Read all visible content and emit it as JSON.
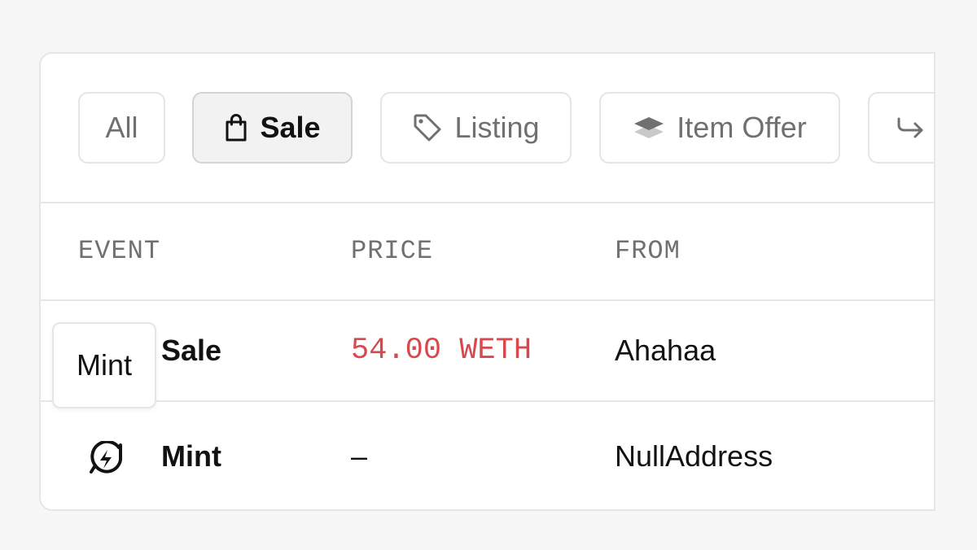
{
  "filters": [
    {
      "label": "All",
      "icon": null,
      "active": false
    },
    {
      "label": "Sale",
      "icon": "shopping-bag-icon",
      "active": true
    },
    {
      "label": "Listing",
      "icon": "tag-icon",
      "active": false
    },
    {
      "label": "Item Offer",
      "icon": "stack-icon",
      "active": false
    },
    {
      "label": "",
      "icon": "transfer-arrow-icon",
      "active": false
    }
  ],
  "table": {
    "columns": [
      "EVENT",
      "PRICE",
      "FROM"
    ],
    "rows": [
      {
        "event": "Sale",
        "event_icon": "shopping-bag-icon",
        "price": "54.00 WETH",
        "from": "Ahahaa"
      },
      {
        "event": "Mint",
        "event_icon": "mint-lightning-icon",
        "price": "–",
        "from": "NullAddress"
      }
    ]
  },
  "tooltip": {
    "text": "Mint"
  },
  "colors": {
    "price_accent": "#d6494f",
    "border": "#e6e6e6",
    "active_chip_bg": "#f2f2f2"
  }
}
